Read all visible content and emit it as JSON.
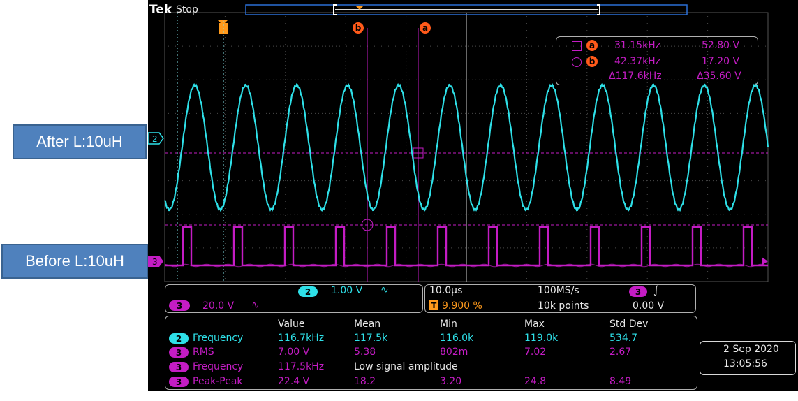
{
  "annotations": {
    "after_label": "After L:10uH",
    "before_label": "Before L:10uH"
  },
  "header": {
    "brand": "Tek",
    "state": "Stop"
  },
  "markers": {
    "trigger": "T",
    "cursor_a": "a",
    "cursor_b": "b"
  },
  "cursor_readout": {
    "a_freq": "31.15kHz",
    "a_volt": "52.80 V",
    "b_freq": "42.37kHz",
    "b_volt": "17.20 V",
    "delta_freq": "Δ117.6kHz",
    "delta_volt": "Δ35.60 V"
  },
  "channels": {
    "ch2": {
      "num": "2",
      "scale": "1.00 V"
    },
    "ch3": {
      "num": "3",
      "scale": "20.0 V"
    }
  },
  "timebase": {
    "horizontal": "10.0µs",
    "sample_rate": "100MS/s",
    "trigger_pos": "9.900 %",
    "record_length": "10k points",
    "trigger_level": "0.00 V",
    "trigger_source": "3"
  },
  "measurements": {
    "headers": [
      "Value",
      "Mean",
      "Min",
      "Max",
      "Std Dev"
    ],
    "rows": [
      {
        "ch": "2",
        "name": "Frequency",
        "value": "116.7kHz",
        "mean": "117.5k",
        "min": "116.0k",
        "max": "119.0k",
        "std": "534.7"
      },
      {
        "ch": "3",
        "name": "RMS",
        "value": "7.00 V",
        "mean": "5.38",
        "min": "802m",
        "max": "7.02",
        "std": "2.67"
      },
      {
        "ch": "3",
        "name": "Frequency",
        "value": "117.5kHz",
        "note": "Low signal amplitude"
      },
      {
        "ch": "3",
        "name": "Peak-Peak",
        "value": "22.4 V",
        "mean": "18.2",
        "min": "3.20",
        "max": "24.8",
        "std": "8.49"
      }
    ]
  },
  "datetime": {
    "date": "2 Sep 2020",
    "time": "13:05:56"
  },
  "colors": {
    "ch2": "#2ee0e8",
    "ch3": "#c41cc4",
    "trigger": "#ff9a1c",
    "cursor": "#ff5a1a"
  }
}
